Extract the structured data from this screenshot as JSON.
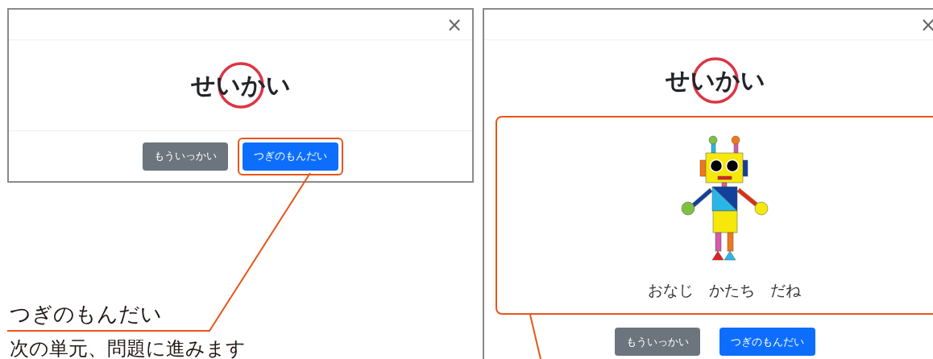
{
  "panels": [
    {
      "modal": {
        "close": "×",
        "title": "せいかい",
        "buttons": [
          {
            "label": "もういっかい",
            "kind": "secondary",
            "highlighted": false
          },
          {
            "label": "つぎのもんだい",
            "kind": "primary",
            "highlighted": true
          }
        ]
      },
      "callout": {
        "label": "つぎのもんだい",
        "description": "次の単元、問題に進みます"
      }
    },
    {
      "modal": {
        "close": "×",
        "title": "せいかい",
        "message": "おなじ　かたち　だね",
        "message_highlighted": true,
        "buttons": [
          {
            "label": "もういっかい",
            "kind": "secondary",
            "highlighted": false
          },
          {
            "label": "つぎのもんだい",
            "kind": "primary",
            "highlighted": false
          }
        ]
      }
    }
  ]
}
